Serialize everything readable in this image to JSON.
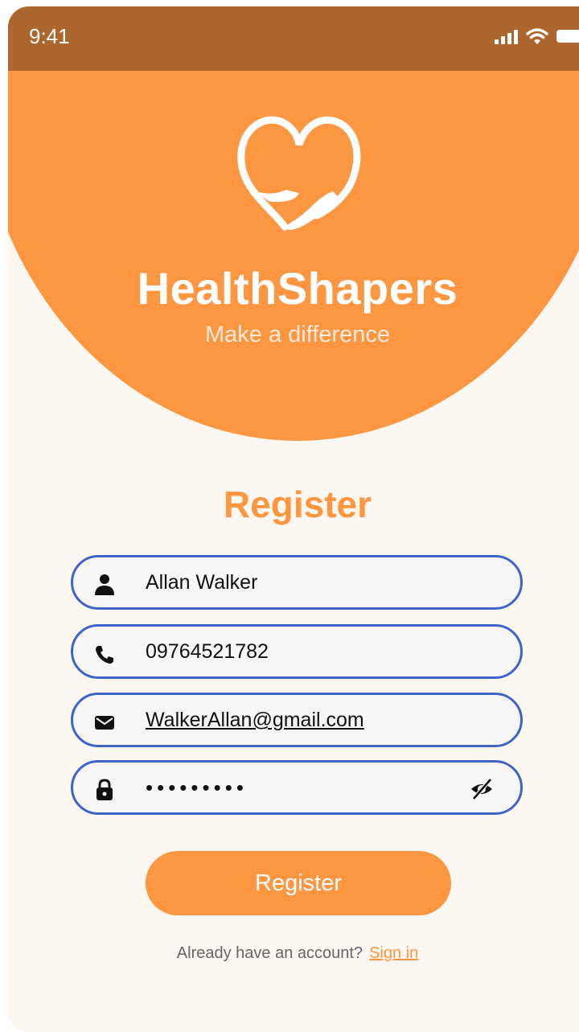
{
  "status_bar": {
    "time": "9:41"
  },
  "brand": {
    "name": "HealthShapers",
    "tagline": "Make a difference",
    "logo_icon": "heart-hands-icon"
  },
  "form": {
    "title": "Register",
    "name_value": "Allan Walker",
    "phone_value": "09764521782",
    "email_value": "WalkerAllan@gmail.com",
    "password_value": "•••••••••",
    "submit_label": "Register"
  },
  "footer": {
    "prompt": "Already have an account?",
    "link": "Sign in"
  },
  "colors": {
    "status_bar": "#ad662d",
    "accent": "#fd9641",
    "background": "#fcf8f1",
    "input_border": "#3e64c8"
  }
}
